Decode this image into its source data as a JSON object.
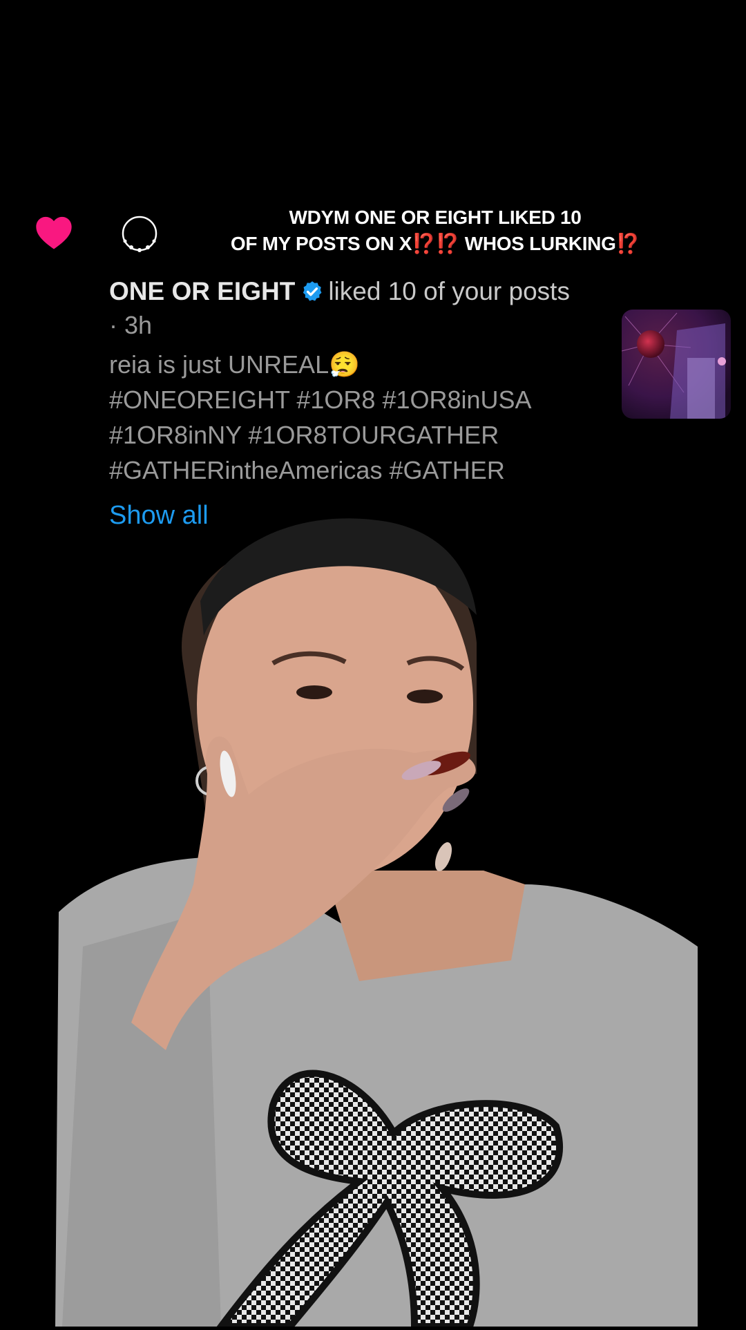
{
  "caption": {
    "line1": "WDYM ONE OR EIGHT LIKED 10",
    "line2_start": "OF MY POSTS ON X",
    "line2_bang1": "⁉️⁉️",
    "line2_mid": " WHOS LURKING",
    "line2_bang2": "⁉️"
  },
  "notification": {
    "account_name": "ONE OR EIGHT",
    "action": "liked 10 of your posts",
    "time": "· 3h",
    "post_lines": [
      "reia is just UNREAL😮‍💨",
      "#ONEOREIGHT #1OR8 #1OR8inUSA",
      "#1OR8inNY #1OR8TOURGATHER",
      "#GATHERintheAmericas #GATHER"
    ],
    "show_all": "Show all"
  },
  "colors": {
    "heart": "#f91880",
    "link": "#1d9bf0",
    "verified": "#1d9bf0",
    "caption_emphasis": "#e0241b"
  },
  "icons": {
    "like": "heart-icon",
    "verified": "verified-badge-icon"
  }
}
